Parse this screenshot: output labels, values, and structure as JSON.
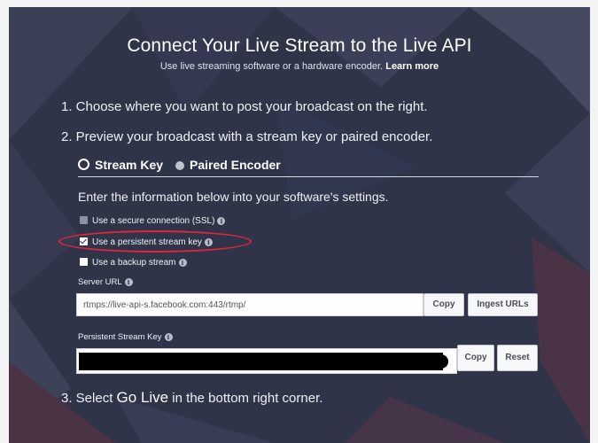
{
  "header": {
    "title": "Connect Your Live Stream to the Live API",
    "subtitle": "Use live streaming software or a hardware encoder.",
    "learn_more": "Learn more"
  },
  "steps": {
    "step1": "1. Choose where you want to post your broadcast on the right.",
    "step2": "2. Preview your broadcast with a stream key or paired encoder.",
    "step3_prefix": "3. Select ",
    "step3_bold": "Go Live",
    "step3_suffix": " in the bottom right corner."
  },
  "tabs": {
    "stream_key": "Stream Key",
    "paired_encoder": "Paired Encoder",
    "selected": "Stream Key"
  },
  "instructions": "Enter the information below into your software's settings.",
  "options": [
    {
      "label": "Use a secure connection (SSL)",
      "checked": true,
      "disabled": true
    },
    {
      "label": "Use a persistent stream key",
      "checked": true,
      "disabled": false
    },
    {
      "label": "Use a backup stream",
      "checked": false,
      "disabled": false
    }
  ],
  "server_url": {
    "label": "Server URL",
    "value": "rtmps://live-api-s.facebook.com:443/rtmp/",
    "copy_label": "Copy",
    "ingest_label": "Ingest URLs"
  },
  "stream_key": {
    "label": "Persistent Stream Key",
    "copy_label": "Copy",
    "reset_label": "Reset"
  },
  "colors": {
    "background": "#2f3449",
    "highlight": "#e0263a"
  }
}
